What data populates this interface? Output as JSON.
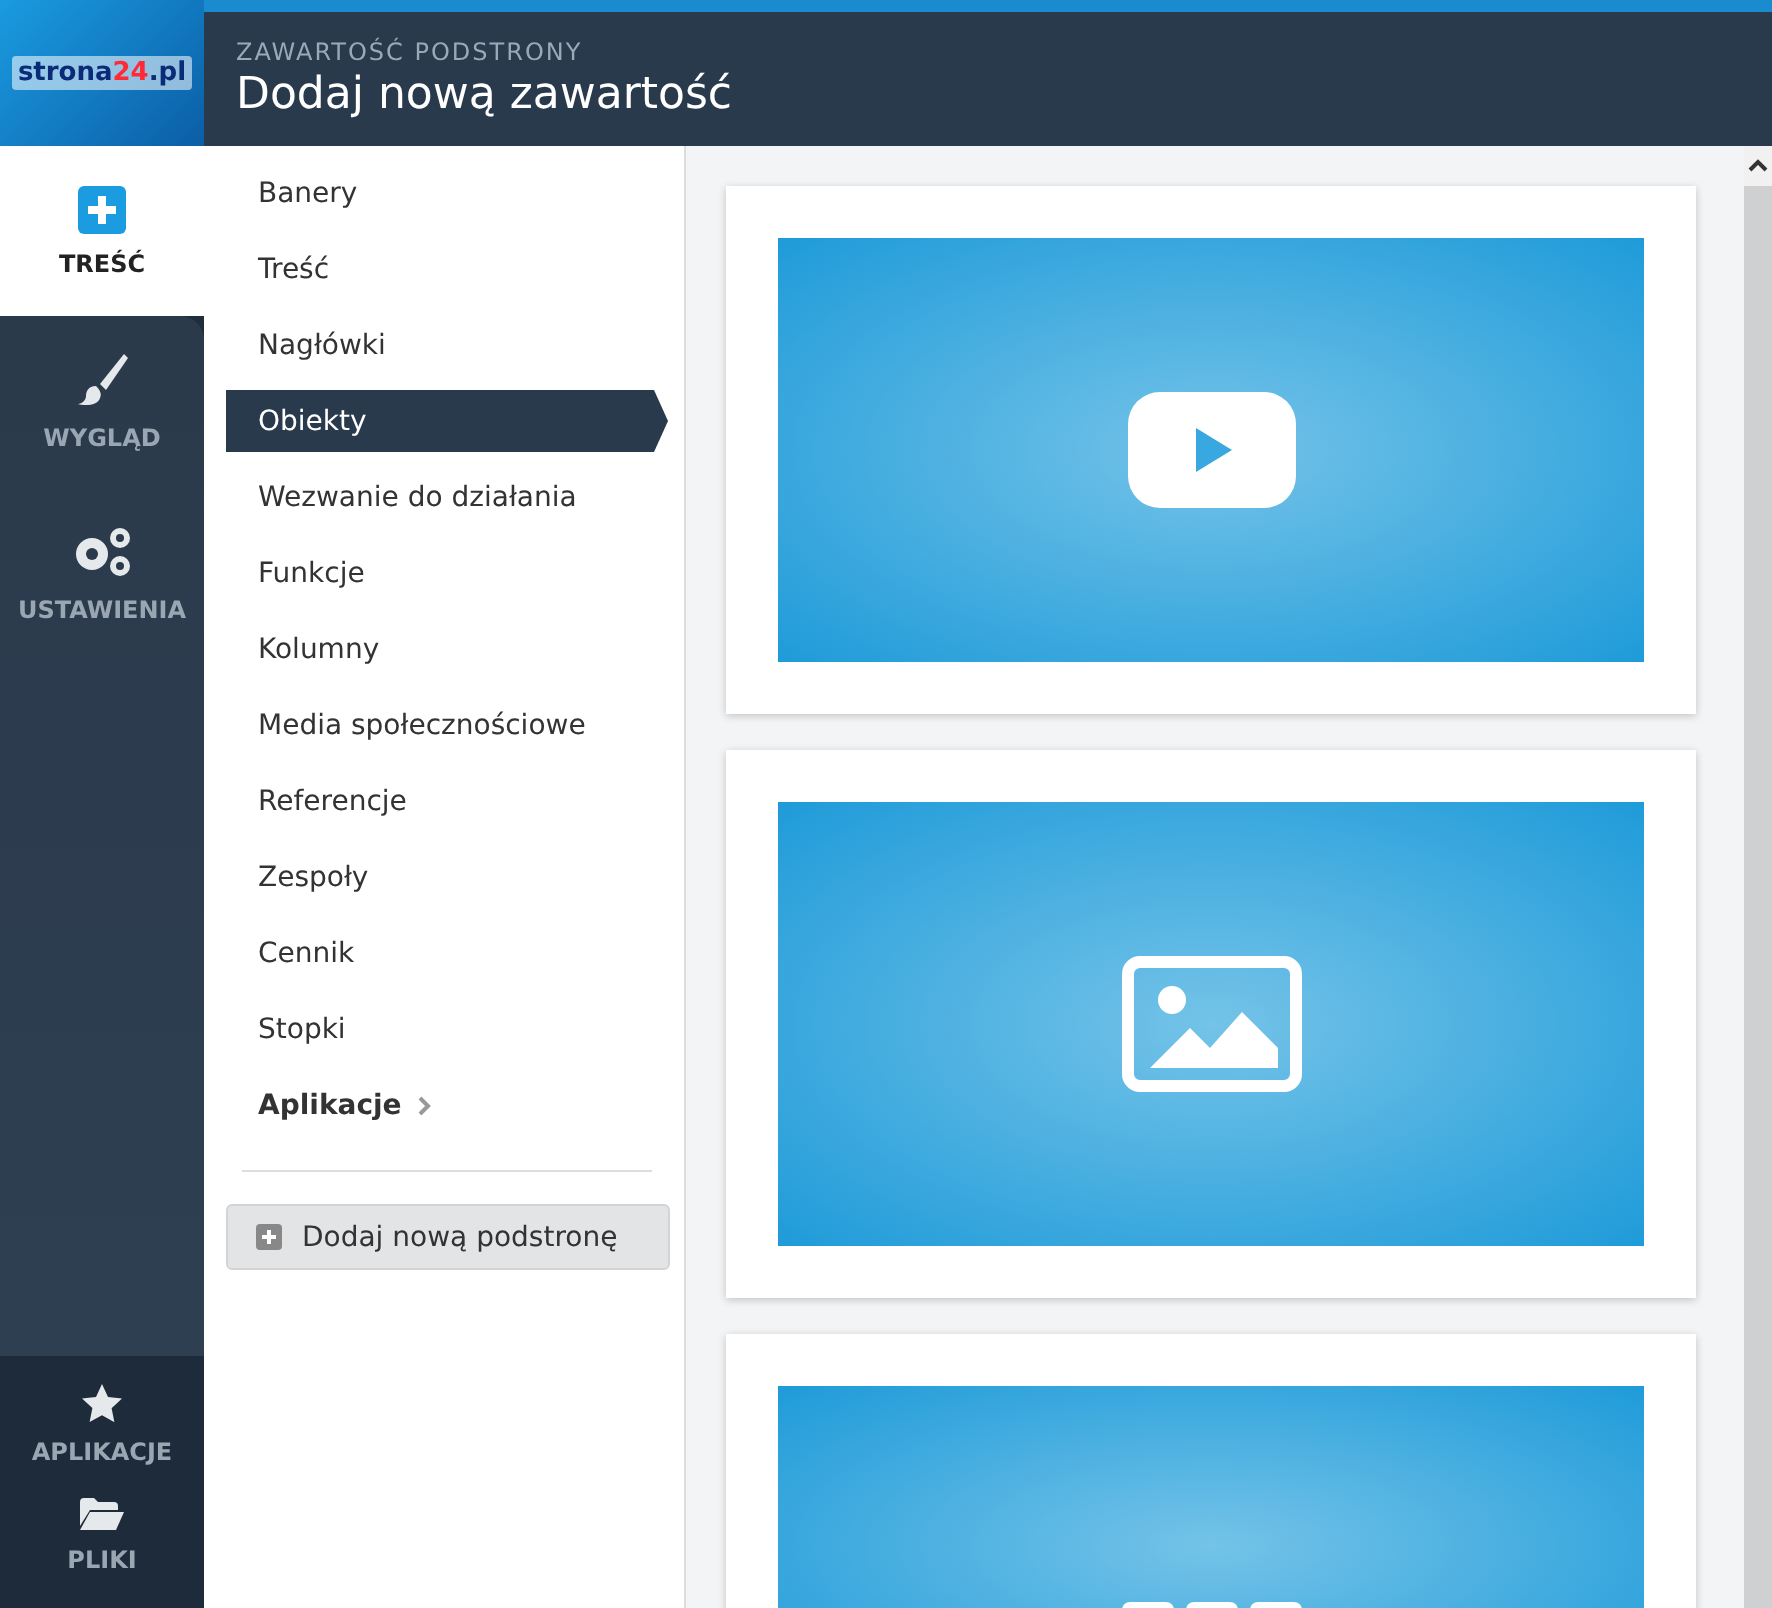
{
  "logo": {
    "parts": [
      {
        "text": "strona",
        "accent": false
      },
      {
        "text": "24",
        "accent": true
      },
      {
        "text": ".pl",
        "accent": false
      }
    ]
  },
  "header": {
    "subtitle": "ZAWARTOŚĆ PODSTRONY",
    "title": "Dodaj nową zawartość"
  },
  "rail": {
    "items": [
      {
        "label": "TREŚĆ",
        "kind": "plus",
        "selected": true
      },
      {
        "label": "WYGLĄD",
        "kind": "brush",
        "selected": false
      },
      {
        "label": "USTAWIENIA",
        "kind": "gears",
        "selected": false
      }
    ],
    "bottom_items": [
      {
        "label": "APLIKACJE",
        "kind": "star"
      },
      {
        "label": "PLIKI",
        "kind": "folder"
      }
    ]
  },
  "menu": {
    "items": [
      {
        "label": "Banery",
        "selected": false,
        "kind": "item"
      },
      {
        "label": "Treść",
        "selected": false,
        "kind": "item"
      },
      {
        "label": "Nagłówki",
        "selected": false,
        "kind": "item"
      },
      {
        "label": "Obiekty",
        "selected": true,
        "kind": "item"
      },
      {
        "label": "Wezwanie do działania",
        "selected": false,
        "kind": "item"
      },
      {
        "label": "Funkcje",
        "selected": false,
        "kind": "item"
      },
      {
        "label": "Kolumny",
        "selected": false,
        "kind": "item"
      },
      {
        "label": "Media społecznościowe",
        "selected": false,
        "kind": "item"
      },
      {
        "label": "Referencje",
        "selected": false,
        "kind": "item"
      },
      {
        "label": "Zespoły",
        "selected": false,
        "kind": "item"
      },
      {
        "label": "Cennik",
        "selected": false,
        "kind": "item"
      },
      {
        "label": "Stopki",
        "selected": false,
        "kind": "item"
      },
      {
        "label": "Aplikacje",
        "selected": false,
        "kind": "submenu"
      }
    ],
    "add_button": "Dodaj nową podstronę"
  },
  "cards": [
    {
      "kind": "video"
    },
    {
      "kind": "image"
    },
    {
      "kind": "grid"
    }
  ]
}
